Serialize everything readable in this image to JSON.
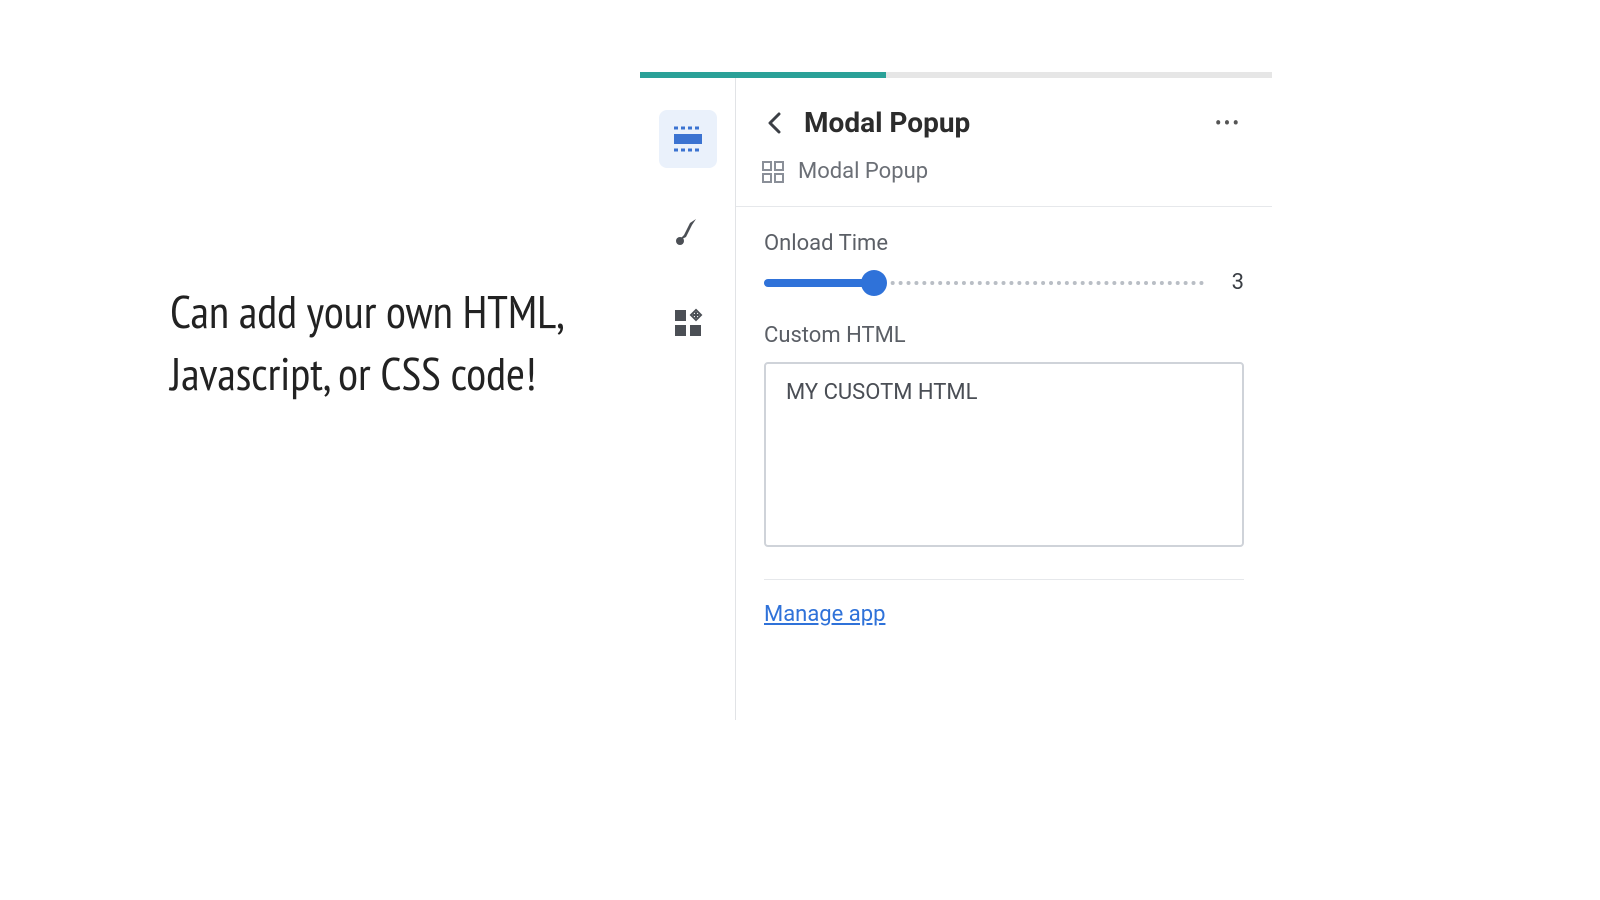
{
  "caption": "Can add your own HTML, Javascript, or CSS code!",
  "panel": {
    "progress_percent": 39,
    "title": "Modal Popup",
    "breadcrumb": "Modal Popup",
    "onload": {
      "label": "Onload Time",
      "value": 3,
      "min": 0,
      "max": 12,
      "fill_percent": 25
    },
    "custom_html": {
      "label": "Custom HTML",
      "value": "MY CUSOTM HTML"
    },
    "manage_link": "Manage app",
    "icons": {
      "section": "section-icon",
      "brush": "brush-icon",
      "apps": "apps-icon",
      "back": "chevron-left-icon",
      "more": "more-horizontal-icon",
      "widget": "widget-icon"
    }
  }
}
